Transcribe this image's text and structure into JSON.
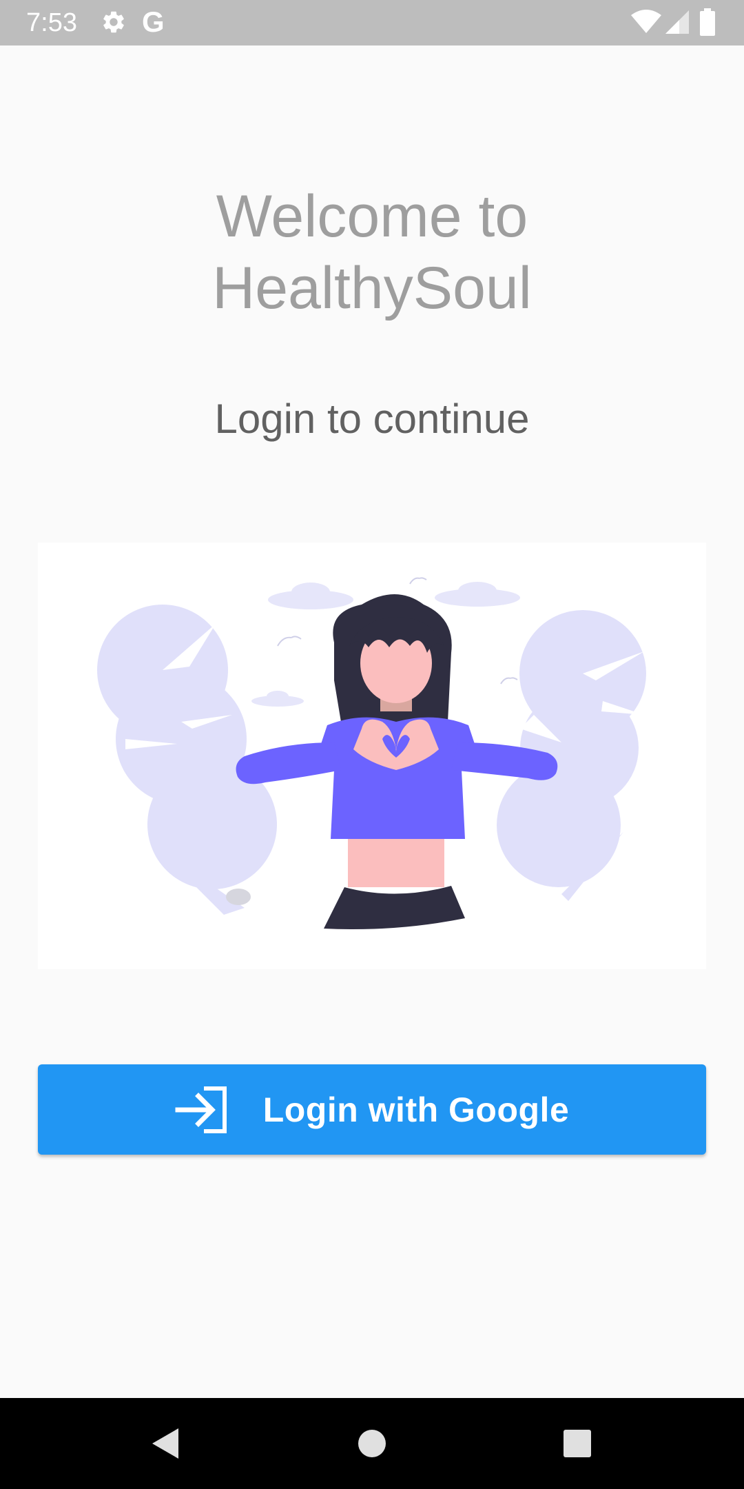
{
  "status_bar": {
    "time": "7:53",
    "google_glyph": "G",
    "icons": [
      "settings-icon",
      "google-icon",
      "wifi-icon",
      "signal-icon",
      "battery-icon"
    ]
  },
  "main": {
    "welcome_line1": "Welcome to",
    "welcome_line2": "HealthySoul",
    "subtitle": "Login to continue",
    "illustration_icon": "woman-heart-hands-illustration"
  },
  "login_button": {
    "label": "Login with Google",
    "icon": "login-icon",
    "color": "#2196f3"
  },
  "nav_bar": {
    "icons": [
      "back-icon",
      "home-icon",
      "recents-icon"
    ]
  },
  "colors": {
    "accent": "#2196f3",
    "illustration_purple": "#6c63ff",
    "illustration_lavender": "#e0e0fa",
    "hair": "#2f2e41",
    "skin": "#fbbebe"
  }
}
